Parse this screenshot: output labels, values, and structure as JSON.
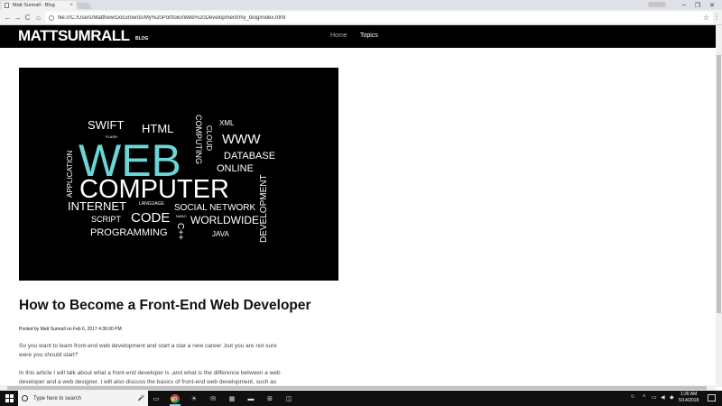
{
  "browser": {
    "tab_title": "Matt Sumrall - Blog",
    "tab_close": "×",
    "url": "file:///C:/Users/Matthew/Documents/My%20Portfolio/Web%20Development/my_blog/index.html",
    "back": "←",
    "forward": "→",
    "reload": "C",
    "home": "⌂",
    "star": "☆",
    "menu": "⋮",
    "minimize": "–",
    "maximize": "❐",
    "close": "✕"
  },
  "site": {
    "logo": "MATTSUMRALL",
    "logo_sub": "BLOG",
    "nav": [
      {
        "label": "Home"
      },
      {
        "label": "Topics"
      }
    ]
  },
  "hero_image": {
    "words": [
      "SWIFT",
      "FLASH",
      "HTML",
      "COMPUTING",
      "CLOUD",
      "XML",
      "WWW",
      "DATABASE",
      "ONLINE",
      "APPLICATION",
      "WEB",
      "COMPUTER",
      "DEVELOPMENT",
      "INTERNET",
      "LANGUAGE",
      "SOCIAL NETWORK",
      "SCRIPT",
      "CODE",
      "NANO",
      "WORLDWIDE",
      "C++",
      "PROGRAMMING",
      "JAVA"
    ],
    "accent": "#6ad6d6"
  },
  "post": {
    "title": "How to Become a Front-End Web Developer",
    "meta": "Posted by Matt Sumrall on Feb 6, 2017 4:36:00 PM",
    "p1_line1": "So you want to learn front-end web development and start a star a new career ,but you are not sure",
    "p1_line2": "were you should start?",
    "p2_line1": "In this article I will talk about what a front-end developer is ,and what is the difference between a web",
    "p2_line2": "developer and a web designer. I will also discuss the basics of front-end web development, such as"
  },
  "taskbar": {
    "search_placeholder": "Type here to search",
    "time": "1:26 AM",
    "date": "5/14/2018"
  }
}
